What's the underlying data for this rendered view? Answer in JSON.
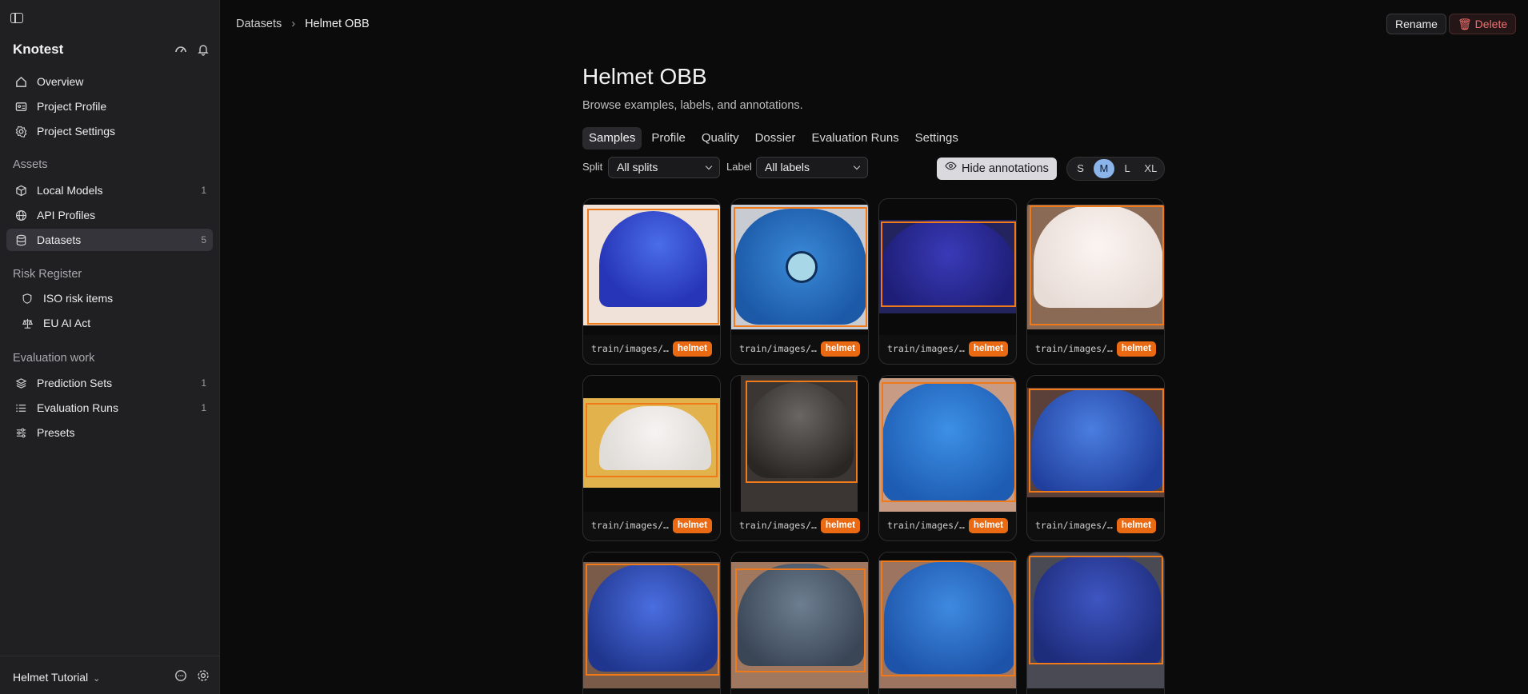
{
  "sidebar": {
    "brand": "Knotest",
    "items_top": [
      {
        "label": "Overview",
        "icon": "home-icon"
      },
      {
        "label": "Project Profile",
        "icon": "id-card-icon"
      },
      {
        "label": "Project Settings",
        "icon": "gear-icon"
      }
    ],
    "assets_title": "Assets",
    "assets": [
      {
        "label": "Local Models",
        "count": "1",
        "icon": "cube-icon"
      },
      {
        "label": "API Profiles",
        "count": "",
        "icon": "globe-icon"
      },
      {
        "label": "Datasets",
        "count": "5",
        "icon": "database-icon"
      }
    ],
    "risk_title": "Risk Register",
    "risk": [
      {
        "label": "ISO risk items",
        "icon": "shield-icon"
      },
      {
        "label": "EU AI Act",
        "icon": "scales-icon"
      }
    ],
    "eval_title": "Evaluation work",
    "eval": [
      {
        "label": "Prediction Sets",
        "count": "1",
        "icon": "layers-icon"
      },
      {
        "label": "Evaluation Runs",
        "count": "1",
        "icon": "list-icon"
      },
      {
        "label": "Presets",
        "count": "",
        "icon": "sliders-icon"
      }
    ],
    "workspace": "Helmet Tutorial"
  },
  "header": {
    "breadcrumb_root": "Datasets",
    "breadcrumb_current": "Helmet OBB",
    "rename": "Rename",
    "delete": "Delete"
  },
  "page": {
    "title": "Helmet OBB",
    "subtitle": "Browse examples, labels, and annotations.",
    "tabs": [
      "Samples",
      "Profile",
      "Quality",
      "Dossier",
      "Evaluation Runs",
      "Settings"
    ],
    "split_label": "Split",
    "split_value": "All splits",
    "label_label": "Label",
    "label_value": "All labels",
    "hide_annotations": "Hide annotations",
    "sizes": [
      "S",
      "M",
      "L",
      "XL"
    ]
  },
  "samples": [
    {
      "path": "train/images/…",
      "label": "helmet"
    },
    {
      "path": "train/images/…",
      "label": "helmet"
    },
    {
      "path": "train/images/…",
      "label": "helmet"
    },
    {
      "path": "train/images/…",
      "label": "helmet"
    },
    {
      "path": "train/images/…",
      "label": "helmet"
    },
    {
      "path": "train/images/…",
      "label": "helmet"
    },
    {
      "path": "train/images/…",
      "label": "helmet"
    },
    {
      "path": "train/images/…",
      "label": "helmet"
    },
    {
      "path": "",
      "label": ""
    },
    {
      "path": "",
      "label": ""
    },
    {
      "path": "",
      "label": ""
    },
    {
      "path": "",
      "label": ""
    }
  ]
}
